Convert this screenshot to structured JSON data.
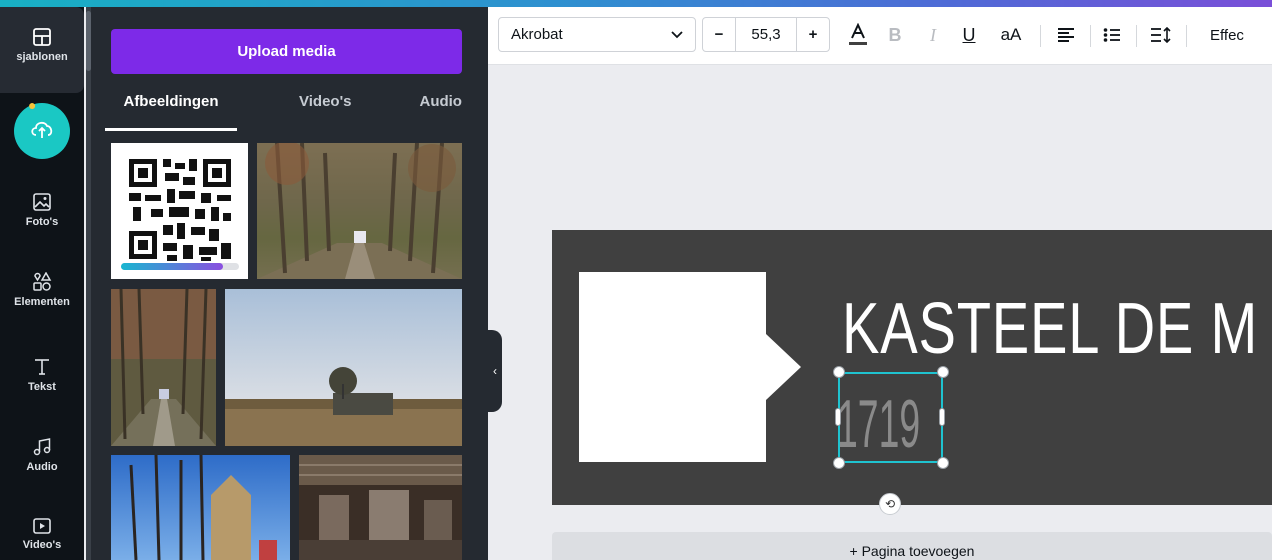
{
  "rail": {
    "items": [
      {
        "label": "sjablonen",
        "icon": "layout-icon"
      },
      {
        "label": "",
        "icon": "upload-cloud-icon"
      },
      {
        "label": "Foto's",
        "icon": "image-icon"
      },
      {
        "label": "Elementen",
        "icon": "shapes-icon"
      },
      {
        "label": "Tekst",
        "icon": "text-icon"
      },
      {
        "label": "Audio",
        "icon": "music-note-icon"
      },
      {
        "label": "Video's",
        "icon": "video-icon"
      }
    ]
  },
  "panel": {
    "upload_label": "Upload media",
    "tabs": [
      {
        "label": "Afbeeldingen",
        "active": true
      },
      {
        "label": "Video's",
        "active": false
      },
      {
        "label": "Audio",
        "active": false
      }
    ],
    "images": [
      {
        "name": "qr-code-image"
      },
      {
        "name": "tree-lane-chapel-image"
      },
      {
        "name": "autumn-lane-image"
      },
      {
        "name": "field-ruin-image"
      },
      {
        "name": "church-trees-image"
      },
      {
        "name": "industrial-hall-image"
      }
    ]
  },
  "toolbar": {
    "font": "Akrobat",
    "minus": "−",
    "font_size": "55,3",
    "plus": "+",
    "case_label": "aA",
    "effects_label": "Effec"
  },
  "canvas": {
    "title": "KASTEEL DE M",
    "year": "1719",
    "add_page_label": "+ Pagina toevoegen"
  },
  "colors": {
    "accent_purple": "#7d2ae8",
    "accent_teal": "#1ac8c4",
    "selection": "#1fc3d0",
    "page_bg": "#404040"
  }
}
